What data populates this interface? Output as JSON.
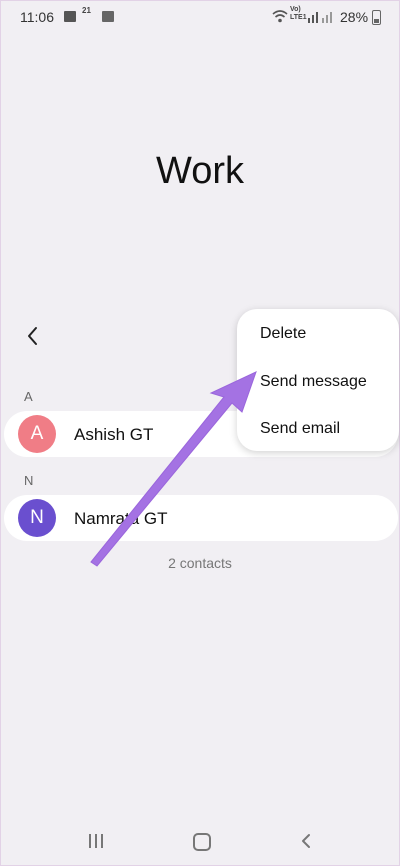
{
  "status_bar": {
    "time": "11:06",
    "notif_text": "21",
    "volte_text": "Vo)",
    "lte_text": "LTE1",
    "battery_percent": "28%"
  },
  "page": {
    "title": "Work",
    "contacts_count": "2 contacts"
  },
  "sections": [
    {
      "letter": "A",
      "contacts": [
        {
          "initial": "A",
          "name": "Ashish GT",
          "avatar_color": "#f07d86"
        }
      ]
    },
    {
      "letter": "N",
      "contacts": [
        {
          "initial": "N",
          "name": "Namrata GT",
          "avatar_color": "#6a4fcf"
        }
      ]
    }
  ],
  "menu": {
    "items": [
      "Delete",
      "Send message",
      "Send email"
    ]
  },
  "annotation": {
    "arrow_color": "#a472e3"
  },
  "icons": {
    "back": "chevron-left-icon",
    "recents": "recent-apps-icon",
    "home": "home-icon",
    "nav_back": "nav-back-icon"
  }
}
